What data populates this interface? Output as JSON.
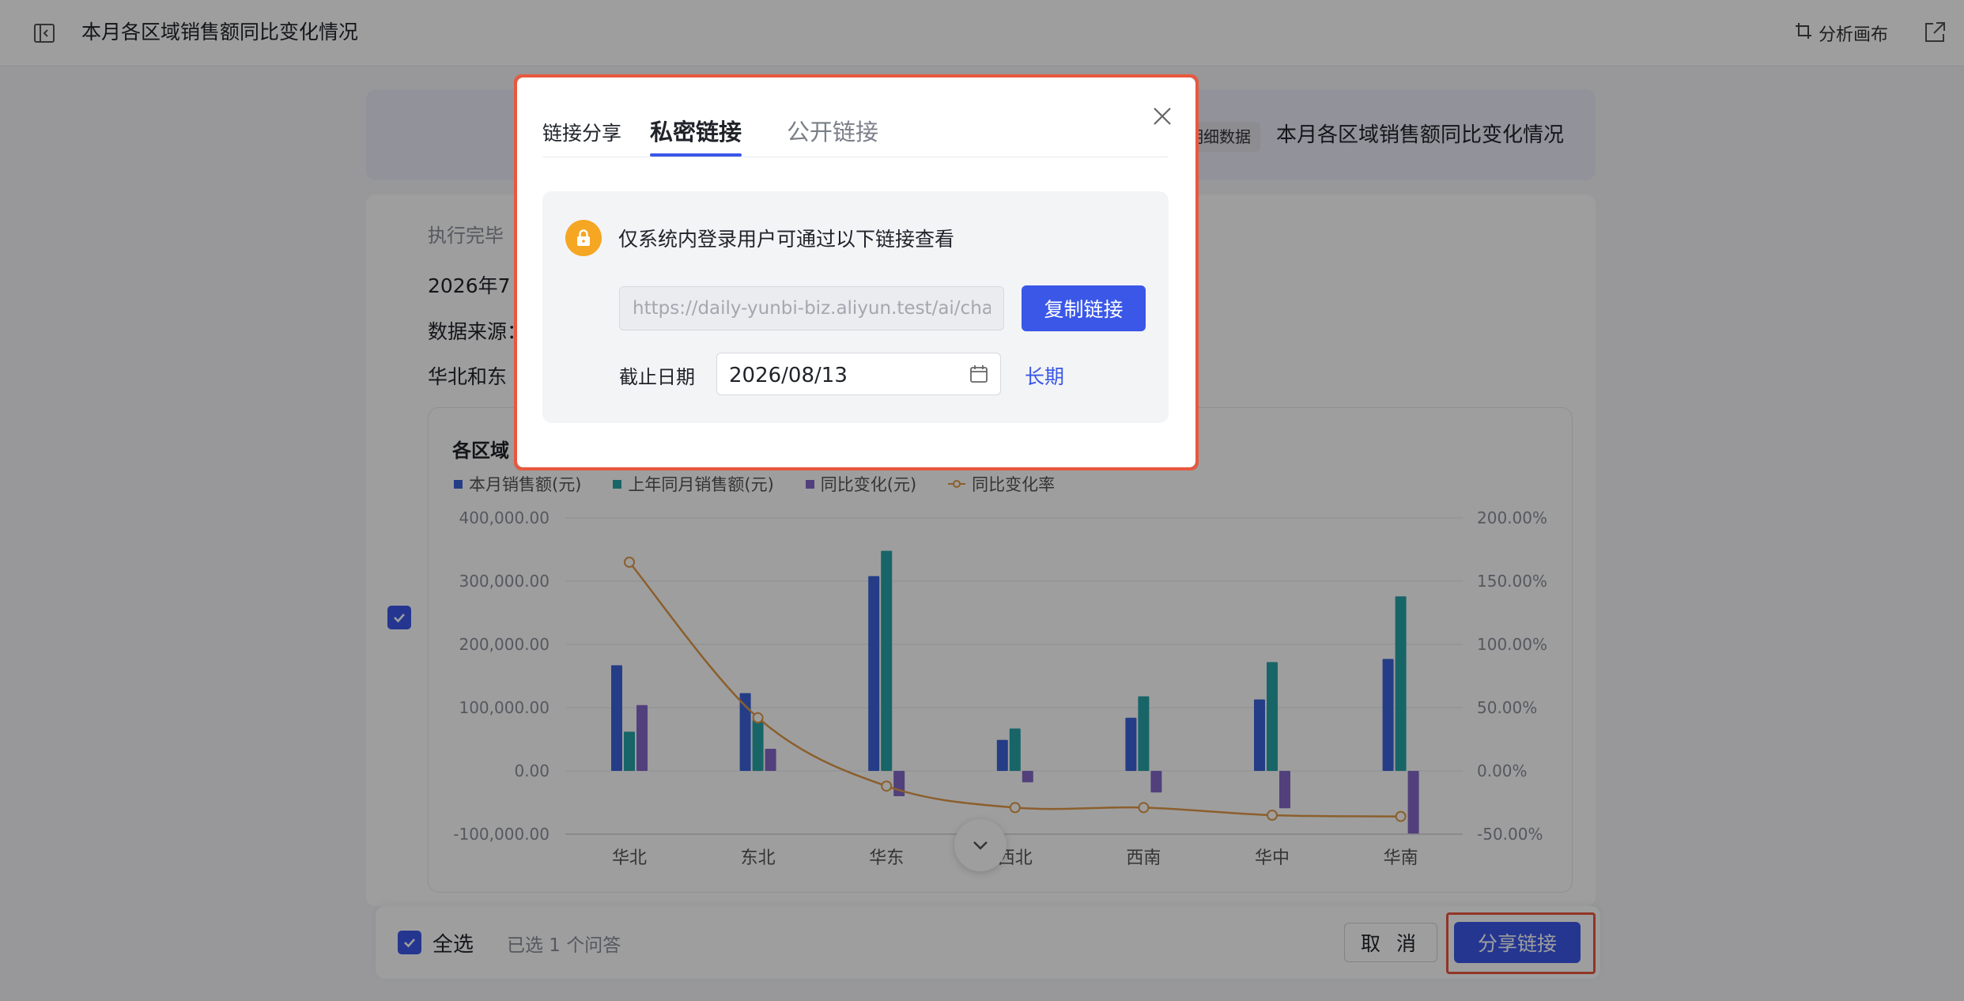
{
  "header": {
    "title": "本月各区域销售额同比变化情况",
    "canvas_label": "分析画布"
  },
  "question": {
    "tag": "明细数据",
    "text": "本月各区域销售额同比变化情况"
  },
  "answer": {
    "status": "执行完毕",
    "line1": "2026年7",
    "line2": "数据来源：",
    "line3": "华北和东"
  },
  "chart_data": {
    "type": "bar",
    "title": "各区域",
    "categories": [
      "华北",
      "东北",
      "华东",
      "西北",
      "西南",
      "华中",
      "华南"
    ],
    "series": [
      {
        "name": "本月销售额(元)",
        "type": "bar",
        "axis": "left",
        "color": "#3a63d8",
        "values": [
          167000,
          123000,
          308000,
          49000,
          84000,
          113000,
          177000
        ]
      },
      {
        "name": "上年同月销售额(元)",
        "type": "bar",
        "axis": "left",
        "color": "#27a3a9",
        "values": [
          62000,
          80000,
          348000,
          67000,
          118000,
          172000,
          276000
        ]
      },
      {
        "name": "同比变化(元)",
        "type": "bar",
        "axis": "left",
        "color": "#8468c9",
        "values": [
          104000,
          35000,
          -40000,
          -18000,
          -34000,
          -59000,
          -99000
        ]
      },
      {
        "name": "同比变化率",
        "type": "line",
        "axis": "right",
        "color": "#e19a4a",
        "values": [
          1.65,
          0.42,
          -0.12,
          -0.29,
          -0.29,
          -0.35,
          -0.36
        ]
      }
    ],
    "left_axis": {
      "ticks": [
        "400,000.00",
        "300,000.00",
        "200,000.00",
        "100,000.00",
        "0.00",
        "-100,000.00"
      ],
      "range": [
        -100000,
        400000
      ]
    },
    "right_axis": {
      "ticks": [
        "200.00%",
        "150.00%",
        "100.00%",
        "50.00%",
        "0.00%",
        "-50.00%"
      ],
      "range": [
        -0.5,
        2.0
      ]
    },
    "grid": true,
    "legend_position": "top-left"
  },
  "bottom_bar": {
    "select_all": "全选",
    "selected_count": "已选 1 个问答",
    "cancel": "取 消",
    "share": "分享链接"
  },
  "modal": {
    "heading": "链接分享",
    "tabs": [
      "私密链接",
      "公开链接"
    ],
    "active_tab": "私密链接",
    "info": "仅系统内登录用户可通过以下链接查看",
    "url": "https://daily-yunbi-biz.aliyun.test/ai/chat",
    "copy_button": "复制链接",
    "deadline_label": "截止日期",
    "deadline_value": "2026/08/13",
    "longterm_link": "长期"
  },
  "colors": {
    "primary": "#3a57e8",
    "highlight": "#e8583e",
    "lock": "#f5a623"
  }
}
